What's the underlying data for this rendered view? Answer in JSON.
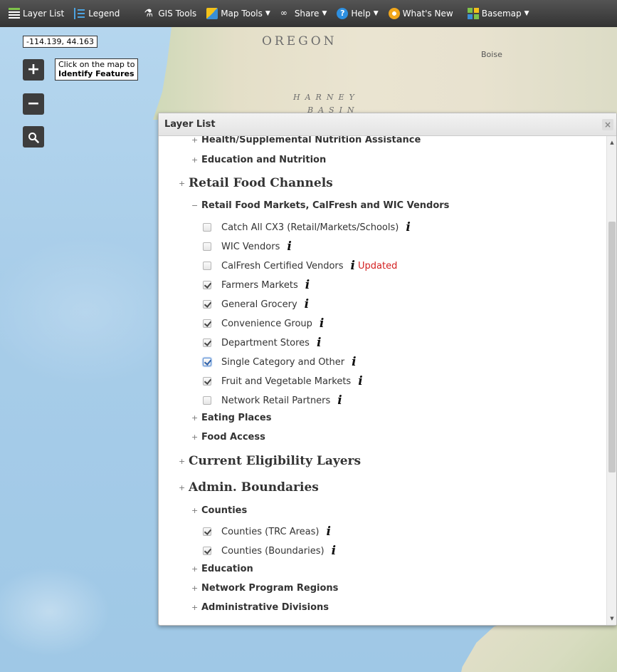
{
  "toolbar": {
    "items": [
      {
        "label": "Layer List"
      },
      {
        "label": "Legend"
      },
      {
        "label": "GIS Tools"
      },
      {
        "label": "Map Tools"
      },
      {
        "label": "Share"
      },
      {
        "label": "Help",
        "icon": "?"
      },
      {
        "label": "What's New"
      },
      {
        "label": "Basemap"
      }
    ]
  },
  "map": {
    "coordinates": "-114.139, 44.163",
    "identify_tip_line1": "Click on the map to",
    "identify_tip_line2": "Identify Features",
    "labels": {
      "oregon": "OREGON",
      "harney": "HARNEY",
      "basin": "BASIN",
      "boise": "Boise"
    },
    "zoom_in": "+",
    "zoom_out": "−"
  },
  "panel": {
    "title": "Layer List",
    "close": "×",
    "items": [
      {
        "text": "Health/Supplemental Nutrition Assistance",
        "expander": "+"
      },
      {
        "text": "Education and Nutrition",
        "expander": "+"
      },
      {
        "text": "Retail Food Channels",
        "expander": "+"
      },
      {
        "text": "Retail Food Markets, CalFresh and WIC Vendors",
        "expander": "−"
      },
      {
        "text": "Catch All CX3 (Retail/Markets/Schools)",
        "checked": false
      },
      {
        "text": "WIC Vendors",
        "checked": false
      },
      {
        "text": "CalFresh Certified Vendors",
        "checked": false,
        "badge": "Updated"
      },
      {
        "text": "Farmers Markets",
        "checked": true
      },
      {
        "text": "General Grocery",
        "checked": true
      },
      {
        "text": "Convenience Group",
        "checked": true
      },
      {
        "text": "Department Stores",
        "checked": true
      },
      {
        "text": "Single Category and Other",
        "checked": true
      },
      {
        "text": "Fruit and Vegetable Markets",
        "checked": true
      },
      {
        "text": "Network Retail Partners",
        "checked": false
      },
      {
        "text": "Eating Places",
        "expander": "+"
      },
      {
        "text": "Food Access",
        "expander": "+"
      },
      {
        "text": "Current Eligibility Layers",
        "expander": "+"
      },
      {
        "text": "Admin. Boundaries",
        "expander": "+"
      },
      {
        "text": "Counties",
        "expander": "+"
      },
      {
        "text": "Counties (TRC Areas)",
        "checked": true
      },
      {
        "text": "Counties (Boundaries)",
        "checked": true
      },
      {
        "text": "Education",
        "expander": "+"
      },
      {
        "text": "Network Program Regions",
        "expander": "+"
      },
      {
        "text": "Administrative Divisions",
        "expander": "+"
      }
    ],
    "info_icon": "i"
  }
}
